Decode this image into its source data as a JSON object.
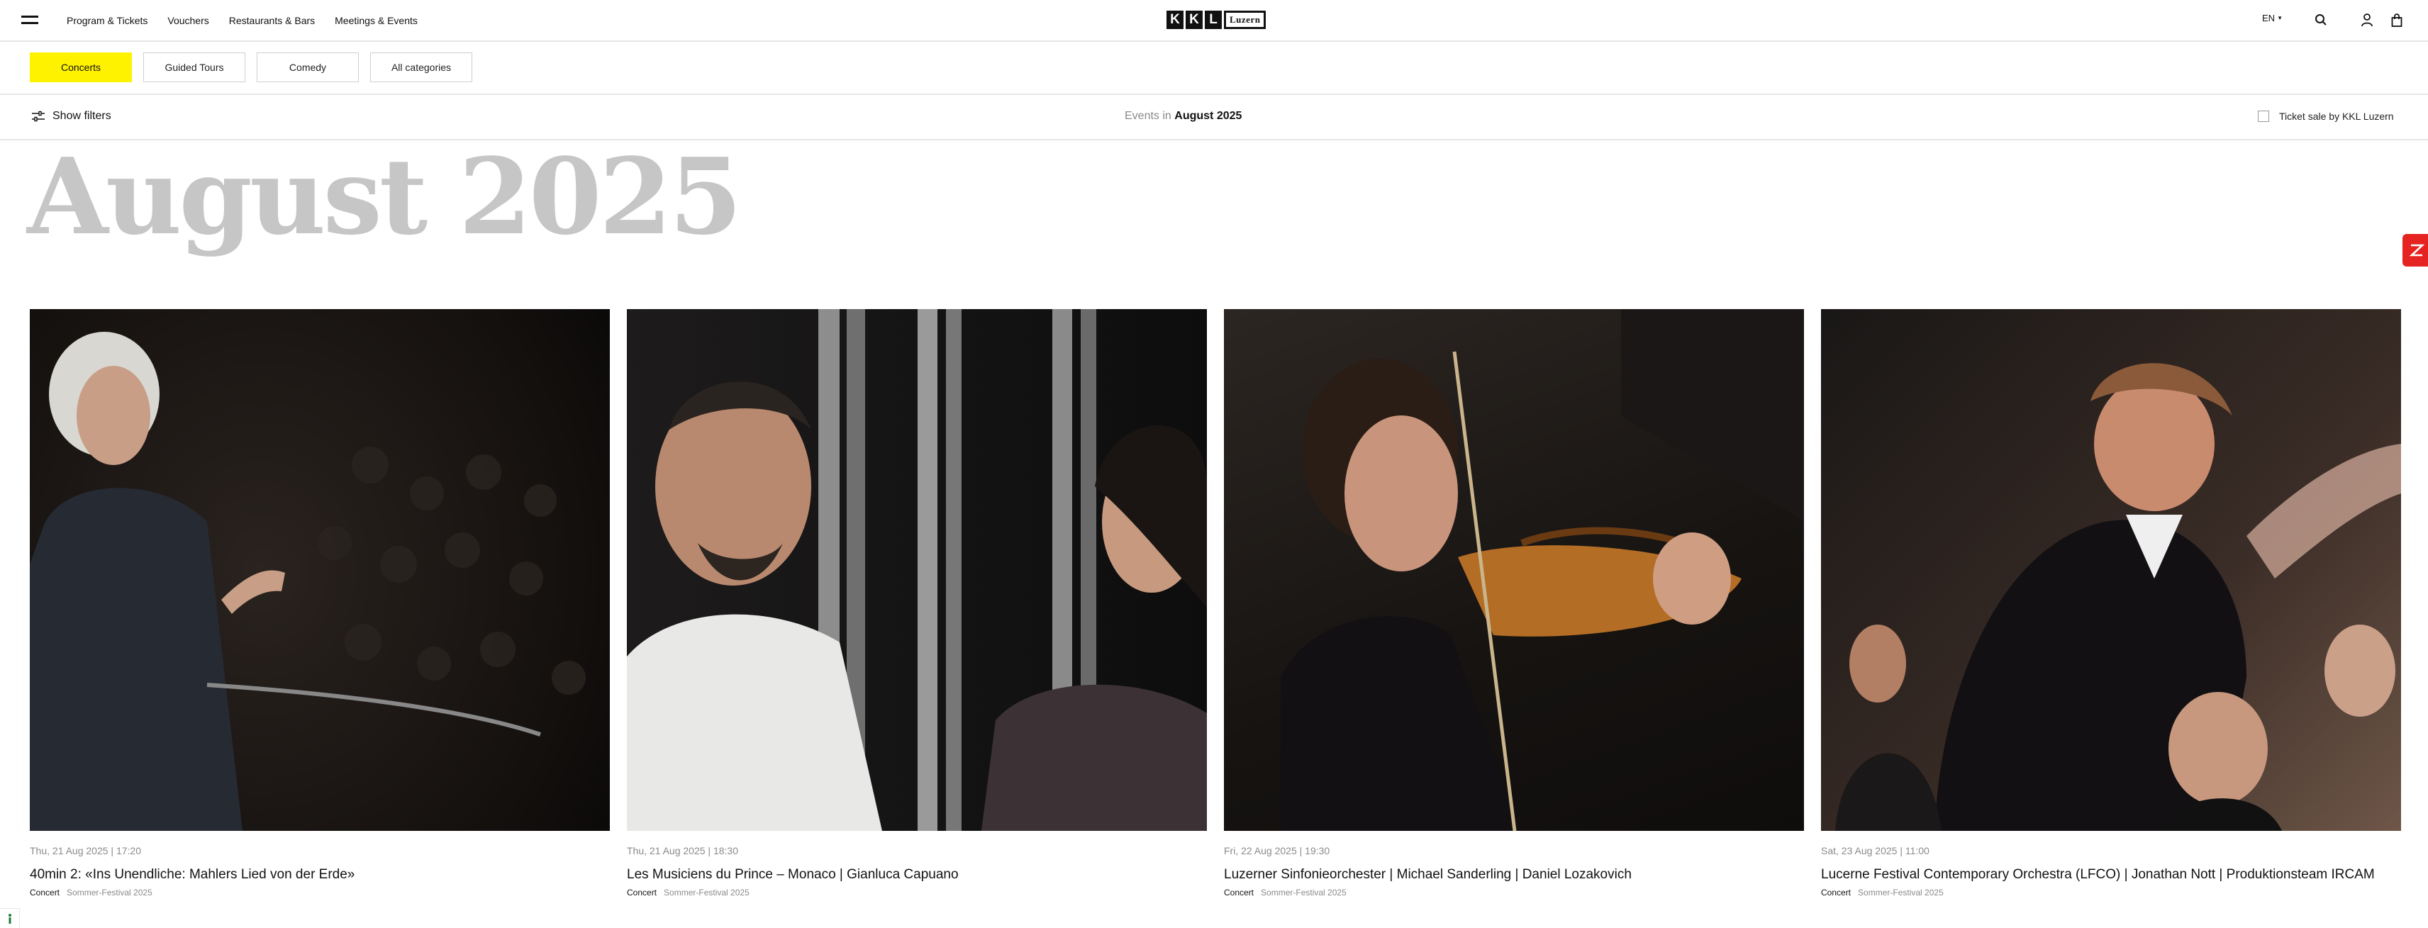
{
  "nav": {
    "items": [
      "Program & Tickets",
      "Vouchers",
      "Restaurants & Bars",
      "Meetings & Events"
    ],
    "language": "EN"
  },
  "logo": {
    "letters": [
      "K",
      "K",
      "L"
    ],
    "word": "Luzern"
  },
  "categories": [
    {
      "label": "Concerts",
      "active": true
    },
    {
      "label": "Guided Tours",
      "active": false
    },
    {
      "label": "Comedy",
      "active": false
    },
    {
      "label": "All categories",
      "active": false
    }
  ],
  "filters": {
    "show_filters_label": "Show filters",
    "events_in_prefix": "Events in",
    "events_in_month": "August 2025",
    "ticket_sale_label": "Ticket sale by KKL Luzern"
  },
  "month_heading": "August 2025",
  "events": [
    {
      "date": "Thu, 21 Aug 2025 | 17:20",
      "title": "40min 2: «Ins Unendliche: Mahlers Lied von der Erde»",
      "type": "Concert",
      "festival": "Sommer-Festival 2025",
      "image": "conductor-speaking-photo"
    },
    {
      "date": "Thu, 21 Aug 2025 | 18:30",
      "title": "Les Musiciens du Prince – Monaco | Gianluca Capuano",
      "type": "Concert",
      "festival": "Sommer-Festival 2025",
      "image": "singers-on-stage-photo"
    },
    {
      "date": "Fri, 22 Aug 2025 | 19:30",
      "title": "Luzerner Sinfonieorchester | Michael Sanderling | Daniel Lozakovich",
      "type": "Concert",
      "festival": "Sommer-Festival 2025",
      "image": "violinist-photo"
    },
    {
      "date": "Sat, 23 Aug 2025 | 11:00",
      "title": "Lucerne Festival Contemporary Orchestra (LFCO) | Jonathan Nott | Produktionsteam IRCAM",
      "type": "Concert",
      "festival": "Sommer-Festival 2025",
      "image": "conductor-with-orchestra-photo"
    }
  ],
  "colors": {
    "accent_yellow": "#fff200",
    "side_tab_red": "#e52320",
    "muted_text": "#8a8a8a",
    "heading_grey": "#c6c6c6"
  }
}
